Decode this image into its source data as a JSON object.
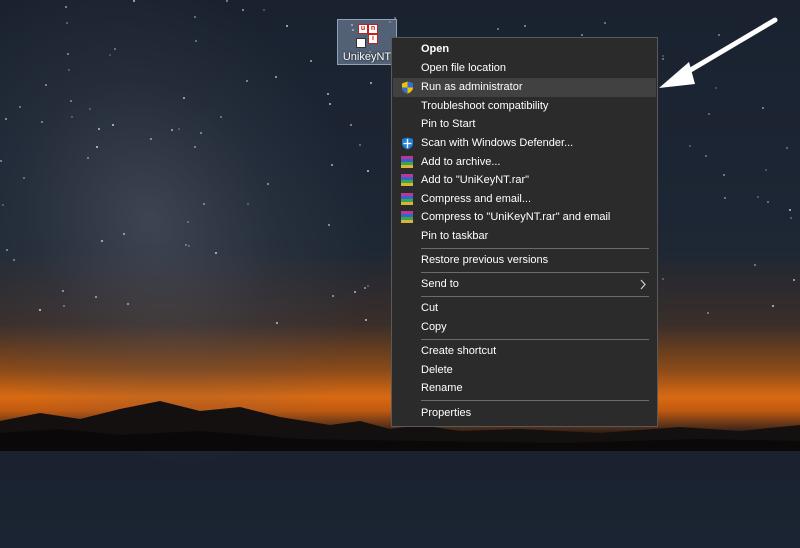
{
  "desktop": {
    "icon_label": "UnikeyNT",
    "icon_glyph_letters": [
      "u",
      "n",
      "i"
    ]
  },
  "context_menu": {
    "items": [
      {
        "label": "Open",
        "bold": true
      },
      {
        "label": "Open file location"
      },
      {
        "label": "Run as administrator",
        "icon": "uac-shield-icon",
        "highlighted": true
      },
      {
        "label": "Troubleshoot compatibility"
      },
      {
        "label": "Pin to Start"
      },
      {
        "label": "Scan with Windows Defender...",
        "icon": "defender-shield-icon"
      },
      {
        "label": "Add to archive...",
        "icon": "winrar-icon"
      },
      {
        "label": "Add to \"UniKeyNT.rar\"",
        "icon": "winrar-icon"
      },
      {
        "label": "Compress and email...",
        "icon": "winrar-icon"
      },
      {
        "label": "Compress to \"UniKeyNT.rar\" and email",
        "icon": "winrar-icon"
      },
      {
        "label": "Pin to taskbar"
      },
      {
        "label": "Restore previous versions"
      },
      {
        "label": "Send to",
        "submenu": true
      },
      {
        "label": "Cut"
      },
      {
        "label": "Copy"
      },
      {
        "label": "Create shortcut"
      },
      {
        "label": "Delete"
      },
      {
        "label": "Rename"
      },
      {
        "label": "Properties"
      }
    ]
  },
  "colors": {
    "menu_bg": "#2b2b2b",
    "menu_hover": "#414141",
    "separator": "#6b6b6b",
    "pointer_arrow": "#ffffff"
  }
}
